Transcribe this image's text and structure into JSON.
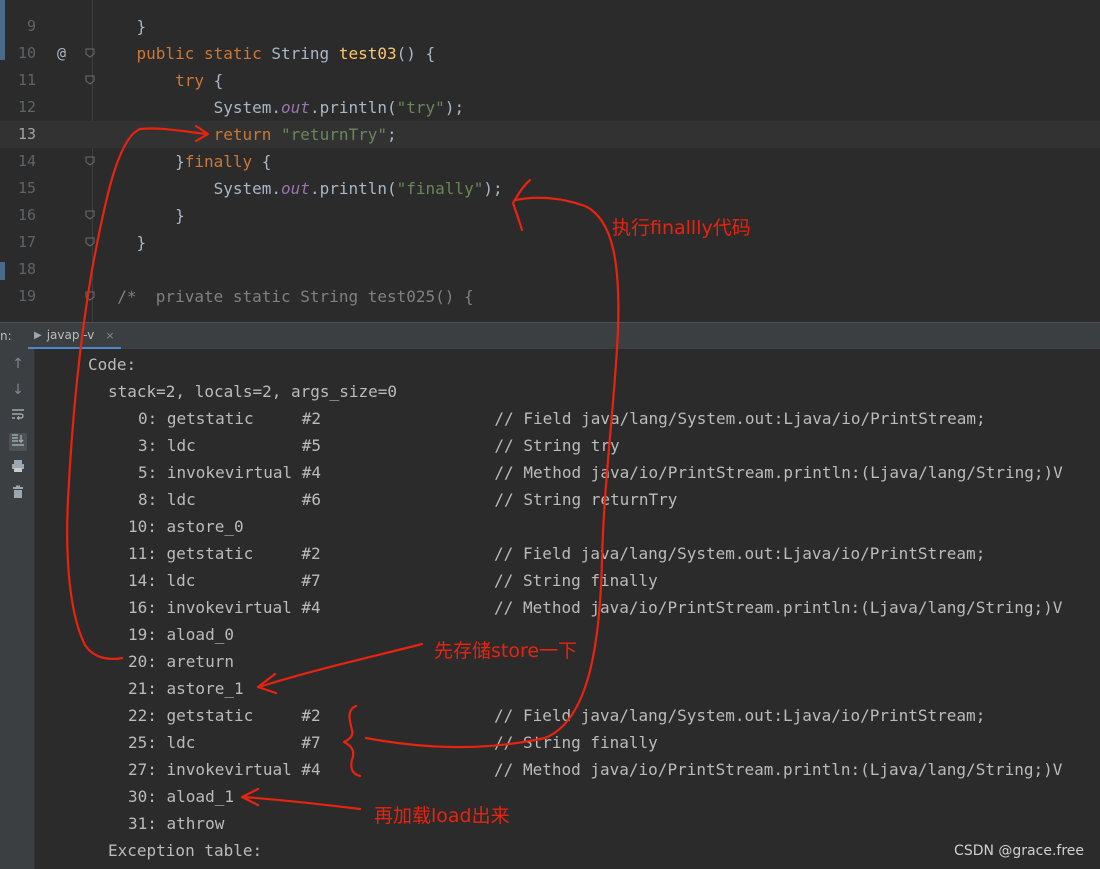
{
  "editor": {
    "lines": [
      {
        "num": "9",
        "tokens": [
          {
            "t": "    }",
            "c": ""
          }
        ]
      },
      {
        "num": "10",
        "marker": "@",
        "tokens": [
          {
            "t": "    ",
            "c": ""
          },
          {
            "t": "public static ",
            "c": "kw"
          },
          {
            "t": "String ",
            "c": ""
          },
          {
            "t": "test03",
            "c": "fn"
          },
          {
            "t": "() {",
            "c": ""
          }
        ]
      },
      {
        "num": "11",
        "tokens": [
          {
            "t": "        ",
            "c": ""
          },
          {
            "t": "try ",
            "c": "kw"
          },
          {
            "t": "{",
            "c": ""
          }
        ]
      },
      {
        "num": "12",
        "tokens": [
          {
            "t": "            System.",
            "c": ""
          },
          {
            "t": "out",
            "c": "fld"
          },
          {
            "t": ".println(",
            "c": ""
          },
          {
            "t": "\"try\"",
            "c": "str"
          },
          {
            "t": ");",
            "c": ""
          }
        ]
      },
      {
        "num": "13",
        "current": true,
        "tokens": [
          {
            "t": "            ",
            "c": ""
          },
          {
            "t": "return ",
            "c": "kw"
          },
          {
            "t": "\"returnTry\"",
            "c": "str"
          },
          {
            "t": ";",
            "c": ""
          }
        ]
      },
      {
        "num": "14",
        "tokens": [
          {
            "t": "        }",
            "c": ""
          },
          {
            "t": "finally ",
            "c": "kw"
          },
          {
            "t": "{",
            "c": ""
          }
        ]
      },
      {
        "num": "15",
        "tokens": [
          {
            "t": "            System.",
            "c": ""
          },
          {
            "t": "out",
            "c": "fld"
          },
          {
            "t": ".println(",
            "c": ""
          },
          {
            "t": "\"finally\"",
            "c": "str"
          },
          {
            "t": ");",
            "c": ""
          }
        ]
      },
      {
        "num": "16",
        "tokens": [
          {
            "t": "        }",
            "c": ""
          }
        ]
      },
      {
        "num": "17",
        "tokens": [
          {
            "t": "    }",
            "c": ""
          }
        ]
      },
      {
        "num": "18",
        "tokens": []
      },
      {
        "num": "19",
        "tokens": [
          {
            "t": "  /*  private static String test025() {",
            "c": "cmt"
          }
        ]
      }
    ]
  },
  "toolwindow": {
    "run_label": "n:",
    "tab_label": "javap -v",
    "tab_icon": "play-icon",
    "close_glyph": "×",
    "side_icons": [
      "up-arrow-icon",
      "down-arrow-icon",
      "soft-wrap-icon",
      "scroll-to-end-icon",
      "print-icon",
      "trash-icon"
    ]
  },
  "console": {
    "lines": [
      {
        "text": "Code:",
        "indent": 0
      },
      {
        "text": "stack=2, locals=2, args_size=0",
        "indent": 1
      },
      {
        "text": "0: getstatic     #2                  // Field java/lang/System.out:Ljava/io/PrintStream;",
        "indent": 2
      },
      {
        "text": "3: ldc           #5                  // String try",
        "indent": 2
      },
      {
        "text": "5: invokevirtual #4                  // Method java/io/PrintStream.println:(Ljava/lang/String;)V",
        "indent": 2
      },
      {
        "text": "8: ldc           #6                  // String returnTry",
        "indent": 2
      },
      {
        "text": "10: astore_0",
        "indent": 3
      },
      {
        "text": "11: getstatic     #2                  // Field java/lang/System.out:Ljava/io/PrintStream;",
        "indent": 3
      },
      {
        "text": "14: ldc           #7                  // String finally",
        "indent": 3
      },
      {
        "text": "16: invokevirtual #4                  // Method java/io/PrintStream.println:(Ljava/lang/String;)V",
        "indent": 3
      },
      {
        "text": "19: aload_0",
        "indent": 3
      },
      {
        "text": "20: areturn",
        "indent": 3
      },
      {
        "text": "21: astore_1",
        "indent": 3
      },
      {
        "text": "22: getstatic     #2                  // Field java/lang/System.out:Ljava/io/PrintStream;",
        "indent": 3
      },
      {
        "text": "25: ldc           #7                  // String finally",
        "indent": 3
      },
      {
        "text": "27: invokevirtual #4                  // Method java/io/PrintStream.println:(Ljava/lang/String;)V",
        "indent": 3
      },
      {
        "text": "30: aload_1",
        "indent": 3
      },
      {
        "text": "31: athrow",
        "indent": 3
      },
      {
        "text": "Exception table:",
        "indent": 1
      }
    ]
  },
  "annotations": {
    "note_finally": "执行finallly代码",
    "note_store": "先存储store一下",
    "note_load": "再加载load出来",
    "color": "#e8230f"
  },
  "watermark": "CSDN @grace.free"
}
